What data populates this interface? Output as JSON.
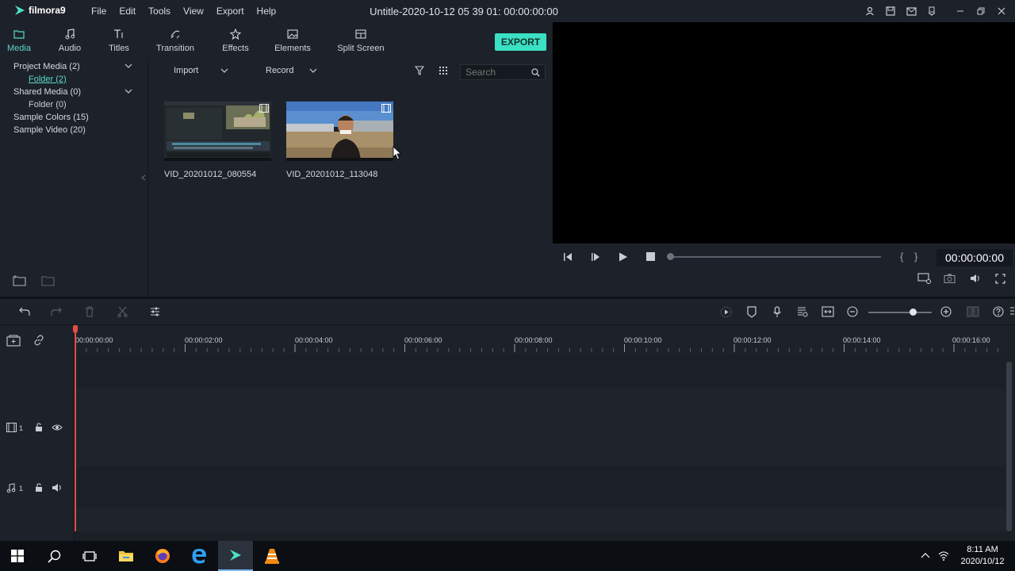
{
  "app": {
    "logo_text": "filmora9",
    "window_title": "Untitle-2020-10-12 05 39 01:  00:00:00:00",
    "menu": [
      "File",
      "Edit",
      "Tools",
      "View",
      "Export",
      "Help"
    ]
  },
  "tabs": [
    {
      "label": "Media",
      "icon": "folder-icon",
      "active": true
    },
    {
      "label": "Audio",
      "icon": "music-note-icon",
      "active": false
    },
    {
      "label": "Titles",
      "icon": "title-t-icon",
      "active": false
    },
    {
      "label": "Transition",
      "icon": "transition-icon",
      "active": false
    },
    {
      "label": "Effects",
      "icon": "effects-icon",
      "active": false
    },
    {
      "label": "Elements",
      "icon": "image-icon",
      "active": false
    },
    {
      "label": "Split Screen",
      "icon": "split-screen-icon",
      "active": false
    }
  ],
  "export_label": "EXPORT",
  "media_tree": {
    "project_media": "Project Media (2)",
    "project_folder": "Folder (2)",
    "shared_media": "Shared Media (0)",
    "shared_folder": "Folder (0)",
    "sample_colors": "Sample Colors (15)",
    "sample_video": "Sample Video (20)"
  },
  "library": {
    "import_label": "Import",
    "record_label": "Record",
    "search_placeholder": "Search",
    "clips": [
      {
        "name": "VID_20201012_080554"
      },
      {
        "name": "VID_20201012_113048"
      }
    ]
  },
  "player": {
    "timecode": "00:00:00:00",
    "progress": 0
  },
  "timeline": {
    "ruler_labels": [
      "00:00:00:00",
      "00:00:02:00",
      "00:00:04:00",
      "00:00:06:00",
      "00:00:08:00",
      "00:00:10:00",
      "00:00:12:00",
      "00:00:14:00",
      "00:00:16:00"
    ],
    "video_track_number": "1",
    "audio_track_number": "1",
    "zoom_level": 0.7
  },
  "taskbar": {
    "time": "8:11 AM",
    "date": "2020/10/12",
    "apps": [
      "start-icon",
      "search-icon",
      "task-view-icon",
      "file-explorer-icon",
      "firefox-icon",
      "edge-icon",
      "filmora-icon",
      "vlc-icon"
    ]
  },
  "colors": {
    "accent": "#5cd6c8",
    "export": "#3be0c4",
    "playhead": "#e84a4a"
  }
}
